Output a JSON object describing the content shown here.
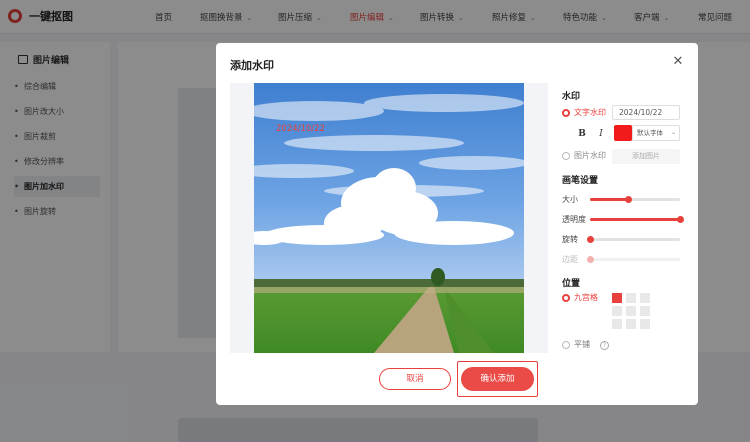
{
  "app": {
    "title": "一键抠图"
  },
  "nav": {
    "items": [
      {
        "label": "首页",
        "chevron": false
      },
      {
        "label": "抠图换背景",
        "chevron": true
      },
      {
        "label": "图片压缩",
        "chevron": true
      },
      {
        "label": "图片编辑",
        "chevron": true,
        "active": true
      },
      {
        "label": "图片转换",
        "chevron": true
      },
      {
        "label": "照片修复",
        "chevron": true
      },
      {
        "label": "特色功能",
        "chevron": true
      },
      {
        "label": "客户端",
        "chevron": true
      },
      {
        "label": "常见问题",
        "chevron": false
      }
    ]
  },
  "sidebar": {
    "title": "图片编辑",
    "items": [
      {
        "label": "综合编辑"
      },
      {
        "label": "图片改大小"
      },
      {
        "label": "图片裁剪"
      },
      {
        "label": "修改分辨率"
      },
      {
        "label": "图片加水印",
        "active": true
      },
      {
        "label": "图片旋转"
      }
    ]
  },
  "modal": {
    "title": "添加水印",
    "preview_watermark": "2024/10/22",
    "watermark": {
      "section_title": "水印",
      "text_option": "文字水印",
      "text_value": "2024/10/22",
      "bold_label": "B",
      "italic_label": "I",
      "color": "#f21a1a",
      "font_select": "默认字体",
      "image_option": "图片水印",
      "add_image_button": "添加图片",
      "selected": "text"
    },
    "brush": {
      "section_title": "画笔设置",
      "size_label": "大小",
      "size_value": 0.42,
      "opacity_label": "透明度",
      "opacity_value": 1.0,
      "rotate_label": "旋转",
      "rotate_value": 0.0,
      "margin_label": "边距",
      "margin_value": 0.0
    },
    "position": {
      "section_title": "位置",
      "grid_option": "九宫格",
      "grid_selected_cell": 0,
      "tile_option": "平铺",
      "selected": "grid"
    },
    "cancel_button": "取消",
    "confirm_button": "确认添加"
  },
  "colors": {
    "accent": "#e8413d",
    "overlay": "rgba(0,0,0,0.45)"
  },
  "icons": {
    "logo": "app-logo-icon",
    "close": "close-icon",
    "help": "help-icon",
    "sidebar": "image-edit-icon"
  }
}
